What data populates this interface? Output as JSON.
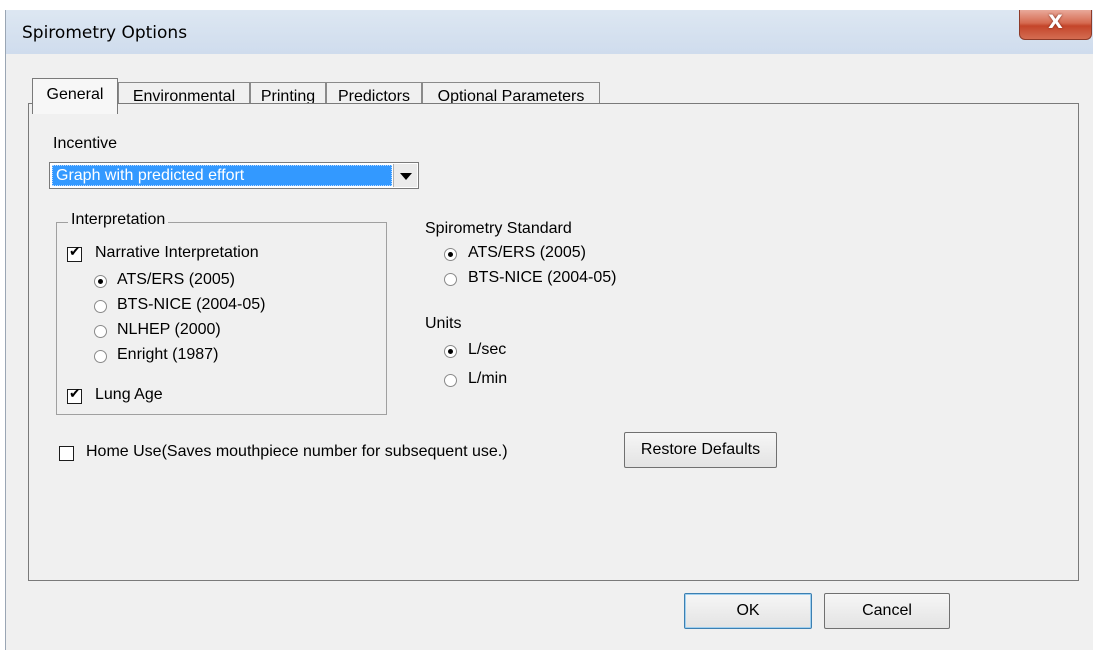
{
  "window": {
    "title": "Spirometry Options",
    "close_glyph": "X"
  },
  "tabs": [
    {
      "label": "General",
      "active": true
    },
    {
      "label": "Environmental",
      "active": false
    },
    {
      "label": "Printing",
      "active": false
    },
    {
      "label": "Predictors",
      "active": false
    },
    {
      "label": "Optional Parameters",
      "active": false
    }
  ],
  "incentive": {
    "label": "Incentive",
    "selected": "Graph with predicted effort"
  },
  "interpretation": {
    "title": "Interpretation",
    "narrative": {
      "label": "Narrative Interpretation",
      "checked": true
    },
    "options": [
      {
        "label": "ATS/ERS (2005)",
        "selected": true
      },
      {
        "label": "BTS-NICE (2004-05)",
        "selected": false
      },
      {
        "label": "NLHEP (2000)",
        "selected": false
      },
      {
        "label": "Enright (1987)",
        "selected": false
      }
    ],
    "lung_age": {
      "label": "Lung Age",
      "checked": true
    }
  },
  "spirometry_standard": {
    "title": "Spirometry Standard",
    "options": [
      {
        "label": "ATS/ERS (2005)",
        "selected": true
      },
      {
        "label": "BTS-NICE (2004-05)",
        "selected": false
      }
    ]
  },
  "units": {
    "title": "Units",
    "options": [
      {
        "label": "L/sec",
        "selected": true
      },
      {
        "label": "L/min",
        "selected": false
      }
    ]
  },
  "home_use": {
    "label": "Home Use(Saves mouthpiece number for subsequent use.)",
    "checked": false
  },
  "buttons": {
    "restore_defaults": "Restore Defaults",
    "ok": "OK",
    "cancel": "Cancel"
  },
  "colors": {
    "selection": "#3399ff",
    "close_button": "#c4452a",
    "dialog_bg": "#f0f0f0"
  },
  "icons": {
    "dropdown": "chevron-down-icon",
    "check": "check-icon",
    "close": "close-icon"
  }
}
